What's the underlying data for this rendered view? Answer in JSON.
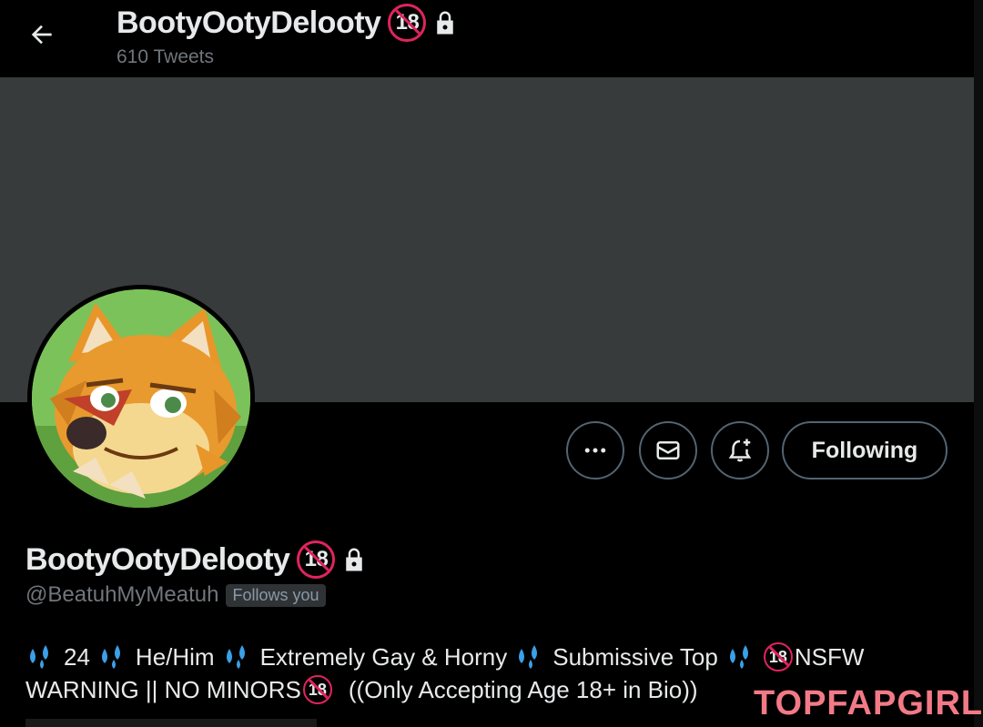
{
  "header": {
    "name": "BootyOotyDelooty",
    "age_badge": "18",
    "tweets_count": "610 Tweets"
  },
  "profile": {
    "display_name": "BootyOotyDelooty",
    "age_badge": "18",
    "handle": "@BeatuhMyMeatuh",
    "follows_you": "Follows you"
  },
  "actions": {
    "more": "more-icon",
    "message": "mail-icon",
    "notify": "bell-plus-icon",
    "following_label": "Following"
  },
  "bio": {
    "line1": {
      "age": "24",
      "pronouns": "He/Him",
      "tag1": "Extremely Gay & Horny",
      "tag2": "Submissive Top",
      "badge": "18",
      "nsfw": "NSFW"
    },
    "line2": {
      "warning": "WARNING || NO MINORS",
      "badge": "18",
      "note": "((Only Accepting Age 18+ in Bio))"
    }
  },
  "watermark": "TOPFAPGIRLS",
  "colors": {
    "background": "#000000",
    "banner": "#373b3b",
    "muted_text": "#71767b",
    "badge_red": "#e0245e",
    "watermark_pink": "#f27a86"
  }
}
